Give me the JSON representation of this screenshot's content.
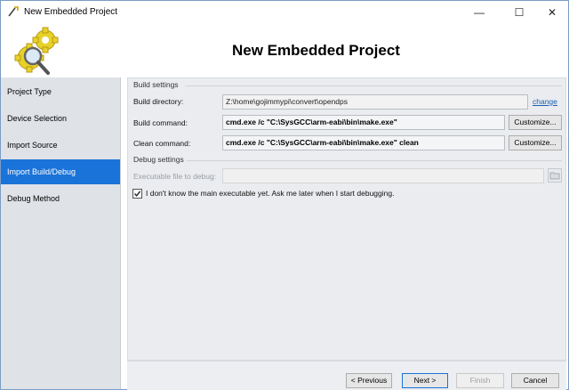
{
  "window": {
    "title": "New Embedded Project",
    "minimize_glyph": "—",
    "maximize_glyph": "☐",
    "close_glyph": "✕"
  },
  "header": {
    "title": "New Embedded Project"
  },
  "sidebar": {
    "items": [
      {
        "label": "Project Type",
        "active": false
      },
      {
        "label": "Device Selection",
        "active": false
      },
      {
        "label": "Import Source",
        "active": false
      },
      {
        "label": "Import Build/Debug",
        "active": true
      },
      {
        "label": "Debug Method",
        "active": false
      }
    ]
  },
  "build_settings": {
    "group_label": "Build settings",
    "directory_label": "Build directory:",
    "directory_value": "Z:\\home\\gojimmypi\\convert\\opendps",
    "change_link": "change",
    "build_command_label": "Build command:",
    "build_command_value": "cmd.exe /c \"C:\\SysGCC\\arm-eabi\\bin\\make.exe\"",
    "clean_command_label": "Clean command:",
    "clean_command_value": "cmd.exe /c \"C:\\SysGCC\\arm-eabi\\bin\\make.exe\" clean",
    "customize_label": "Customize..."
  },
  "debug_settings": {
    "group_label": "Debug settings",
    "executable_label": "Executable file to debug:",
    "executable_value": "",
    "checkbox_checked": true,
    "checkbox_label": "I don't know the main executable yet. Ask me later when I start debugging."
  },
  "footer": {
    "previous_label": "< Previous",
    "next_label": "Next >",
    "finish_label": "Finish",
    "cancel_label": "Cancel"
  },
  "colors": {
    "accent": "#1a73d8",
    "sidebar_bg": "#dfe3e8",
    "panel_bg": "#eaecef",
    "link": "#1a5fb4"
  }
}
